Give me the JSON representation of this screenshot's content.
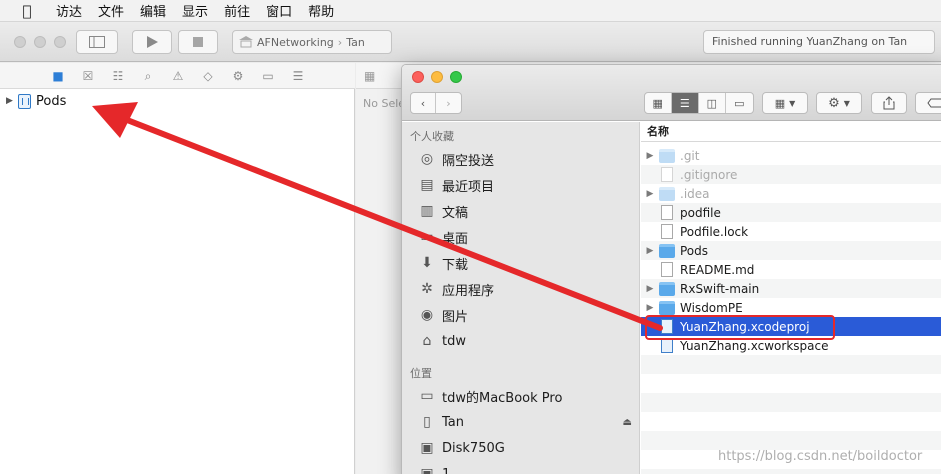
{
  "menubar": {
    "apple_icon": "apple-icon",
    "items": [
      "访达",
      "文件",
      "编辑",
      "显示",
      "前往",
      "窗口",
      "帮助"
    ]
  },
  "xcode": {
    "scheme": {
      "project": "AFNetworking",
      "device": "Tan"
    },
    "status": "Finished running YuanZhang on Tan",
    "navigator": {
      "root_item": "Pods"
    },
    "editor": {
      "placeholder": "No Sele"
    }
  },
  "finder": {
    "sidebar": {
      "favorites_header": "个人收藏",
      "favorites": [
        {
          "label": "隔空投送",
          "icon": "airdrop-icon"
        },
        {
          "label": "最近项目",
          "icon": "recents-icon"
        },
        {
          "label": "文稿",
          "icon": "documents-icon"
        },
        {
          "label": "桌面",
          "icon": "desktop-icon"
        },
        {
          "label": "下载",
          "icon": "downloads-icon"
        },
        {
          "label": "应用程序",
          "icon": "applications-icon"
        },
        {
          "label": "图片",
          "icon": "pictures-icon"
        },
        {
          "label": "tdw",
          "icon": "home-icon"
        }
      ],
      "locations_header": "位置",
      "locations": [
        {
          "label": "tdw的MacBook Pro",
          "icon": "laptop-icon"
        },
        {
          "label": "Tan",
          "icon": "iphone-icon"
        },
        {
          "label": "Disk750G",
          "icon": "disk-icon"
        },
        {
          "label": "1",
          "icon": "disk-icon"
        }
      ]
    },
    "list": {
      "column_header": "名称",
      "rows": [
        {
          "name": ".git",
          "kind": "folder",
          "expandable": true,
          "hidden": true
        },
        {
          "name": ".gitignore",
          "kind": "file",
          "expandable": false,
          "hidden": true
        },
        {
          "name": ".idea",
          "kind": "folder",
          "expandable": true,
          "hidden": true
        },
        {
          "name": "podfile",
          "kind": "file",
          "expandable": false,
          "hidden": false
        },
        {
          "name": "Podfile.lock",
          "kind": "file",
          "expandable": false,
          "hidden": false
        },
        {
          "name": "Pods",
          "kind": "folder",
          "expandable": true,
          "hidden": false
        },
        {
          "name": "README.md",
          "kind": "markdown",
          "expandable": false,
          "hidden": false
        },
        {
          "name": "RxSwift-main",
          "kind": "folder",
          "expandable": true,
          "hidden": false
        },
        {
          "name": "WisdomPE",
          "kind": "folder",
          "expandable": true,
          "hidden": false
        },
        {
          "name": "YuanZhang.xcodeproj",
          "kind": "xcodeproj",
          "expandable": false,
          "hidden": false,
          "selected": true
        },
        {
          "name": "YuanZhang.xcworkspace",
          "kind": "xcworkspace",
          "expandable": false,
          "hidden": false
        }
      ]
    }
  },
  "annotation": {
    "color": "#e5282a"
  },
  "watermark": "https://blog.csdn.net/boildoctor"
}
